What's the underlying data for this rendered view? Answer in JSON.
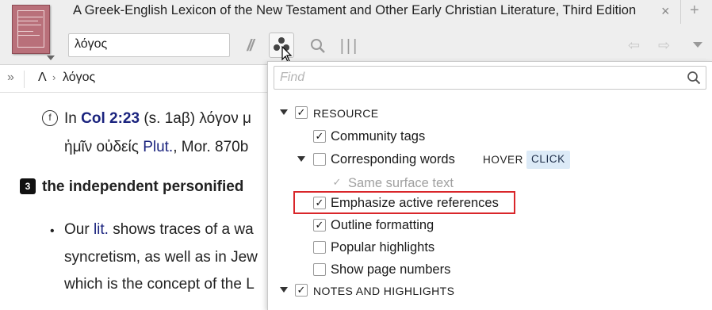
{
  "tab": {
    "title": "A Greek-English Lexicon of the New Testament and Other Early Christian Literature, Third Edition",
    "close_glyph": "×",
    "new_glyph": "+"
  },
  "toolbar": {
    "search_value": "λόγος",
    "parallel_glyph": "//",
    "visual_filters_icon": "three-dots-icon",
    "search_icon": "magnifier-icon",
    "columns_glyph": "|||",
    "back_glyph": "⇦",
    "forward_glyph": "⇨"
  },
  "breadcrumb": {
    "expand_glyph": "»",
    "section": "Λ",
    "separator": "›",
    "entry": "λόγος"
  },
  "article": {
    "line1_marker": "f",
    "line1_pre": "In ",
    "line1_ref": "Col 2:23",
    "line1_post": " (s. 1aβ) λόγον μ",
    "line2_pre": "ἡμῖν οὐδείς ",
    "line2_link": "Plut.",
    "line2_post": ", Mor. 870b",
    "sense_number": "3",
    "sense_heading": "the independent personified",
    "bullet_glyph": "•",
    "bullet_pre": "Our ",
    "bullet_link": "lit.",
    "bullet_post": " shows traces of a wa",
    "line4": "syncretism, as well as in Jew",
    "line5": "which is the concept of the L"
  },
  "popup": {
    "find_placeholder": "Find",
    "sections": [
      {
        "label": "RESOURCE",
        "checked": true,
        "expanded": true,
        "items": [
          {
            "label": "Community tags",
            "checked": true
          },
          {
            "label": "Corresponding words",
            "checked": false,
            "expanded": true,
            "mode_hover": "HOVER",
            "mode_click": "CLICK",
            "children": [
              {
                "label": "Same surface text",
                "checked": true,
                "disabled": true
              }
            ]
          },
          {
            "label": "Emphasize active references",
            "checked": true,
            "highlighted": true
          },
          {
            "label": "Outline formatting",
            "checked": true
          },
          {
            "label": "Popular highlights",
            "checked": false
          },
          {
            "label": "Show page numbers",
            "checked": false
          }
        ]
      },
      {
        "label": "NOTES AND HIGHLIGHTS",
        "checked": true,
        "expanded": true
      }
    ],
    "check_glyph": "✓"
  },
  "colors": {
    "highlight_border": "#d9262a",
    "click_chip_bg": "#dceaf7",
    "reference_text": "#1a237e",
    "toolbar_bg": "#eeeeee"
  }
}
